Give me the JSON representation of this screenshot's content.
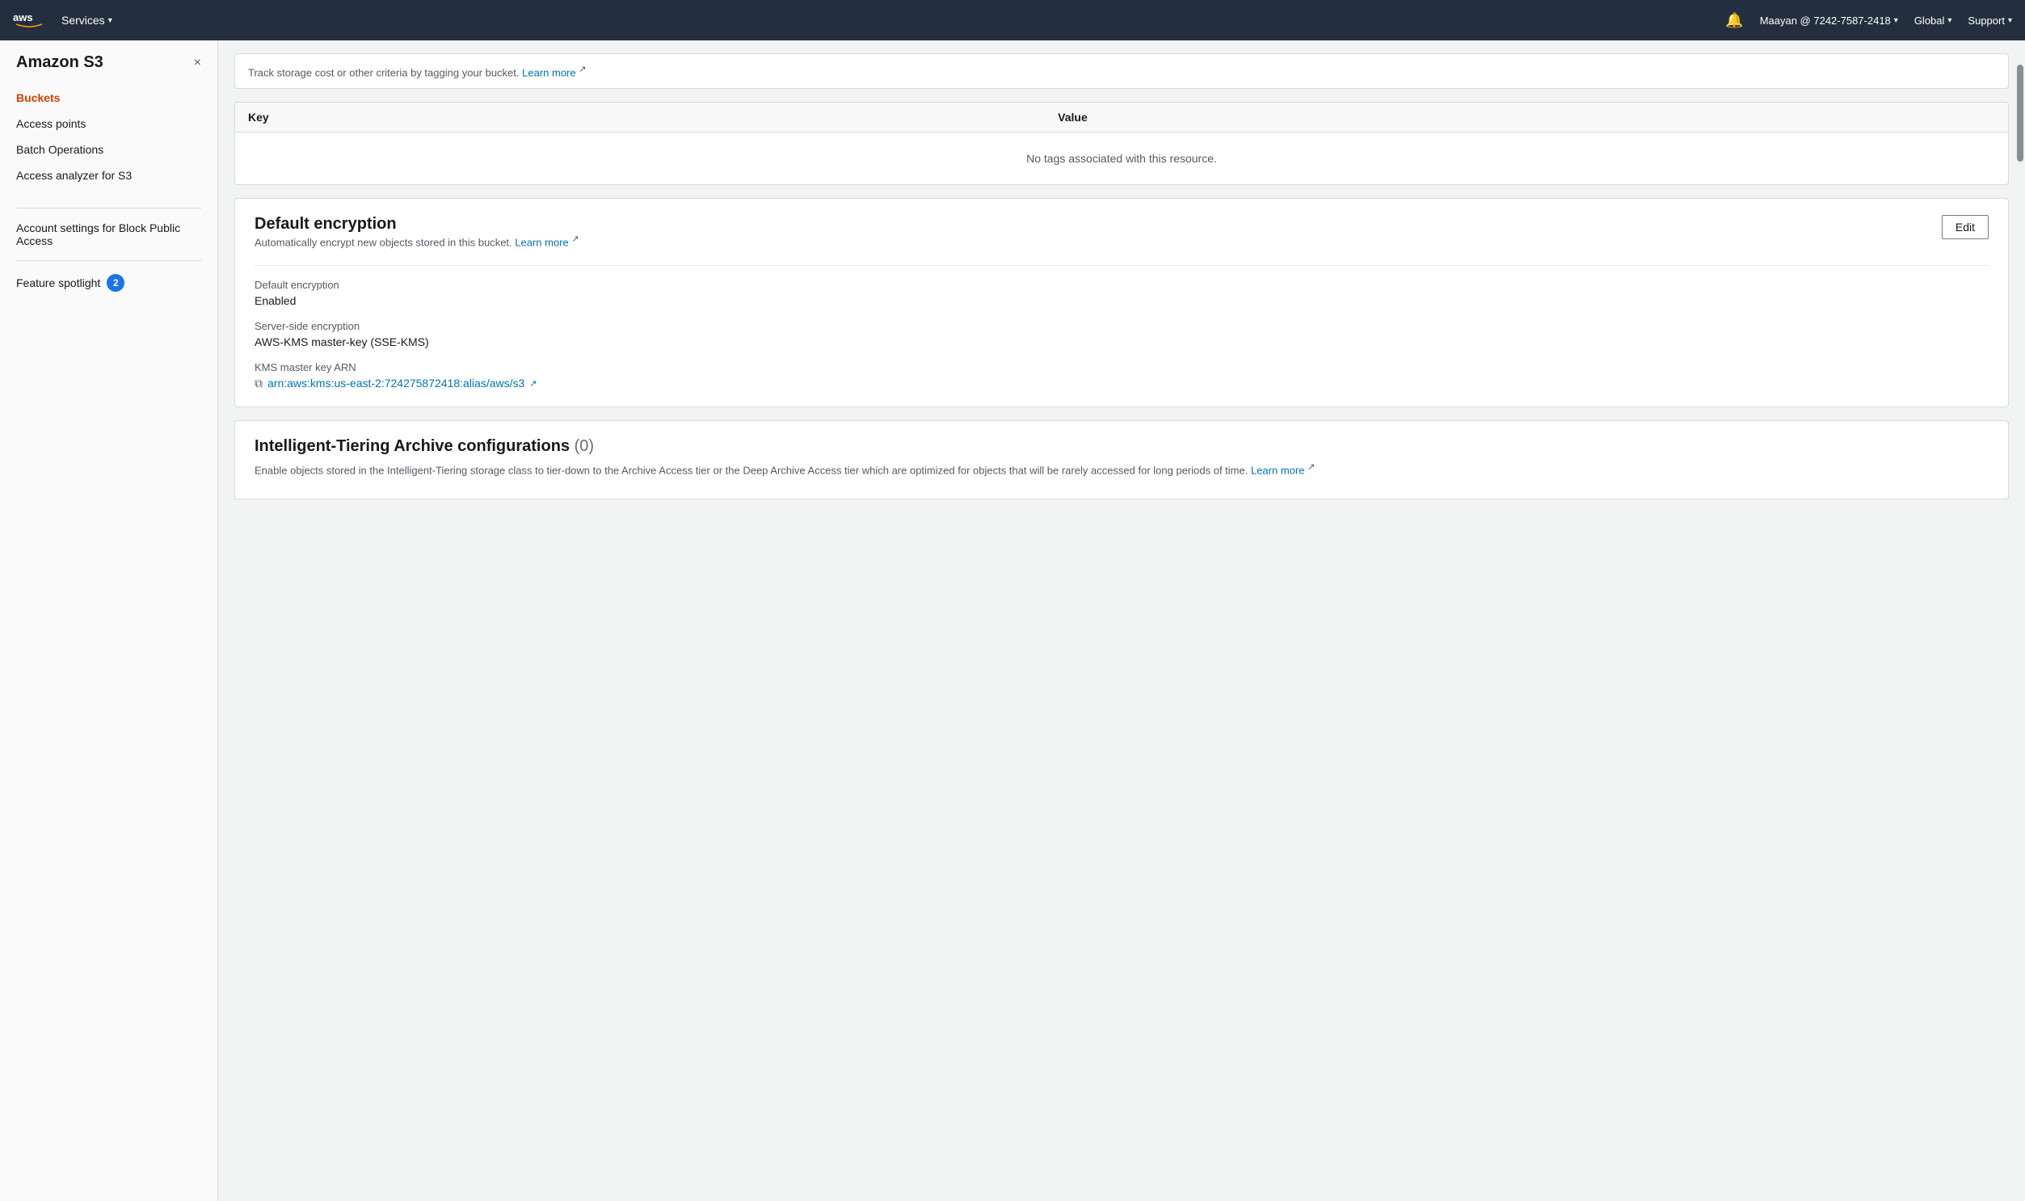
{
  "topNav": {
    "logoText": "aws",
    "servicesLabel": "Services",
    "bellIcon": "🔔",
    "userLabel": "Maayan @ 7242-7587-2418",
    "globalLabel": "Global",
    "supportLabel": "Support"
  },
  "sidebar": {
    "title": "Amazon S3",
    "closeLabel": "×",
    "navItems": [
      {
        "id": "buckets",
        "label": "Buckets",
        "active": true
      },
      {
        "id": "access-points",
        "label": "Access points",
        "active": false
      },
      {
        "id": "batch-operations",
        "label": "Batch Operations",
        "active": false
      },
      {
        "id": "access-analyzer",
        "label": "Access analyzer for S3",
        "active": false
      }
    ],
    "accountSettings": "Account settings for Block Public Access",
    "featureSpotlight": {
      "label": "Feature spotlight",
      "badge": "2"
    }
  },
  "tagsSection": {
    "noticeText": "Track storage cost or other criteria by tagging your bucket.",
    "learnMoreLabel": "Learn more",
    "keyHeader": "Key",
    "valueHeader": "Value",
    "emptyMessage": "No tags associated with this resource."
  },
  "defaultEncryption": {
    "title": "Default encryption",
    "editLabel": "Edit",
    "subtitle": "Automatically encrypt new objects stored in this bucket.",
    "learnMoreLabel": "Learn more",
    "fields": [
      {
        "label": "Default encryption",
        "value": "Enabled"
      },
      {
        "label": "Server-side encryption",
        "value": "AWS-KMS master-key (SSE-KMS)"
      },
      {
        "label": "KMS master key ARN",
        "value": ""
      }
    ],
    "kmsArn": "arn:aws:kms:us-east-2:724275872418:alias/aws/s3"
  },
  "intelligentTiering": {
    "title": "Intelligent-Tiering Archive configurations",
    "count": "(0)",
    "description": "Enable objects stored in the Intelligent-Tiering storage class to tier-down to the Archive Access tier or the Deep Archive Access tier which are optimized for objects that will be rarely accessed for long periods of time.",
    "learnMoreLabel": "Learn more"
  }
}
